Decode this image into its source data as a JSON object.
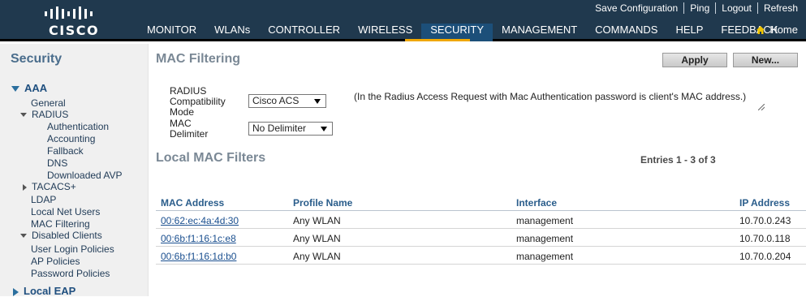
{
  "brand": {
    "name": "CISCO"
  },
  "top_links": [
    "Save Configuration",
    "Ping",
    "Logout",
    "Refresh"
  ],
  "nav": {
    "items": [
      "MONITOR",
      "WLANs",
      "CONTROLLER",
      "WIRELESS",
      "SECURITY",
      "MANAGEMENT",
      "COMMANDS",
      "HELP",
      "FEEDBACK"
    ],
    "active": "SECURITY",
    "home": "Home",
    "accent": "#f0a700"
  },
  "sidebar": {
    "title": "Security",
    "aaa": {
      "label": "AAA",
      "general": "General",
      "radius": "RADIUS",
      "radius_items": [
        "Authentication",
        "Accounting",
        "Fallback",
        "DNS",
        "Downloaded AVP"
      ],
      "tacacs": "TACACS+",
      "ldap": "LDAP",
      "local_net_users": "Local Net Users",
      "mac_filtering": "MAC Filtering",
      "disabled_clients": "Disabled Clients",
      "user_login_policies": "User Login Policies",
      "ap_policies": "AP Policies",
      "password_policies": "Password Policies"
    },
    "local_eap": "Local EAP"
  },
  "page": {
    "title": "MAC Filtering",
    "apply_label": "Apply",
    "new_label": "New...",
    "radius_mode_label_lines": [
      "RADIUS",
      "Compatibility",
      "Mode"
    ],
    "radius_mode_value": "Cisco ACS",
    "mac_delimiter_label_lines": [
      "MAC",
      "Delimiter"
    ],
    "mac_delimiter_value": "No Delimiter",
    "note": "(In the Radius Access Request with Mac Authentication password is client's MAC address.)",
    "section_title": "Local MAC Filters",
    "entries": "Entries 1 - 3 of 3"
  },
  "table": {
    "headers": [
      "MAC Address",
      "Profile Name",
      "Interface",
      "IP Address"
    ],
    "rows": [
      {
        "mac": "00:62:ec:4a:4d:30",
        "profile": "Any WLAN",
        "interface": "management",
        "ip": "10.70.0.243"
      },
      {
        "mac": "00:6b:f1:16:1c:e8",
        "profile": "Any WLAN",
        "interface": "management",
        "ip": "10.70.0.118"
      },
      {
        "mac": "00:6b:f1:16:1d:b0",
        "profile": "Any WLAN",
        "interface": "management",
        "ip": "10.70.0.204"
      }
    ]
  }
}
